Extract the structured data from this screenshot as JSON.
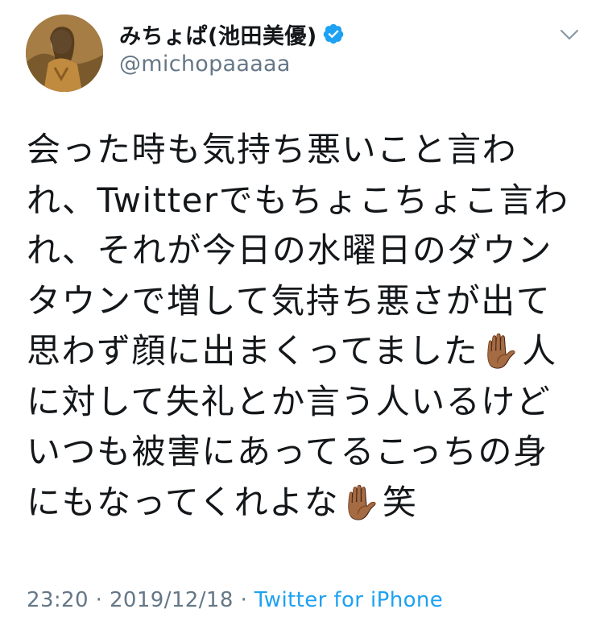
{
  "user": {
    "display_name": "みちょぱ(池田美優)",
    "username": "@michopaaaaa",
    "verified": true
  },
  "tweet": {
    "lines": [
      "会った時も気持ち悪いこと言わ",
      "れ、Twitterでもちょこちょこ言わ",
      "れ、それが今日の水曜日のダウン",
      "タウンで増して気持ち悪さが出て",
      "思わず顔に出まくってました✋🏾人",
      "に対して失礼とか言う人いるけど",
      "いつも被害にあってるこっちの身",
      "にもなってくれよな✋🏾笑"
    ]
  },
  "meta": {
    "time": "23:20",
    "separator1": " · ",
    "date": "2019/12/18",
    "separator2": " · ",
    "source": "Twitter for iPhone"
  },
  "icons": {
    "verified": "verified-badge-icon",
    "menu": "chevron-down-icon"
  },
  "colors": {
    "text": "#14171a",
    "secondary": "#657786",
    "link": "#1da1f2",
    "verified": "#1da1f2"
  }
}
